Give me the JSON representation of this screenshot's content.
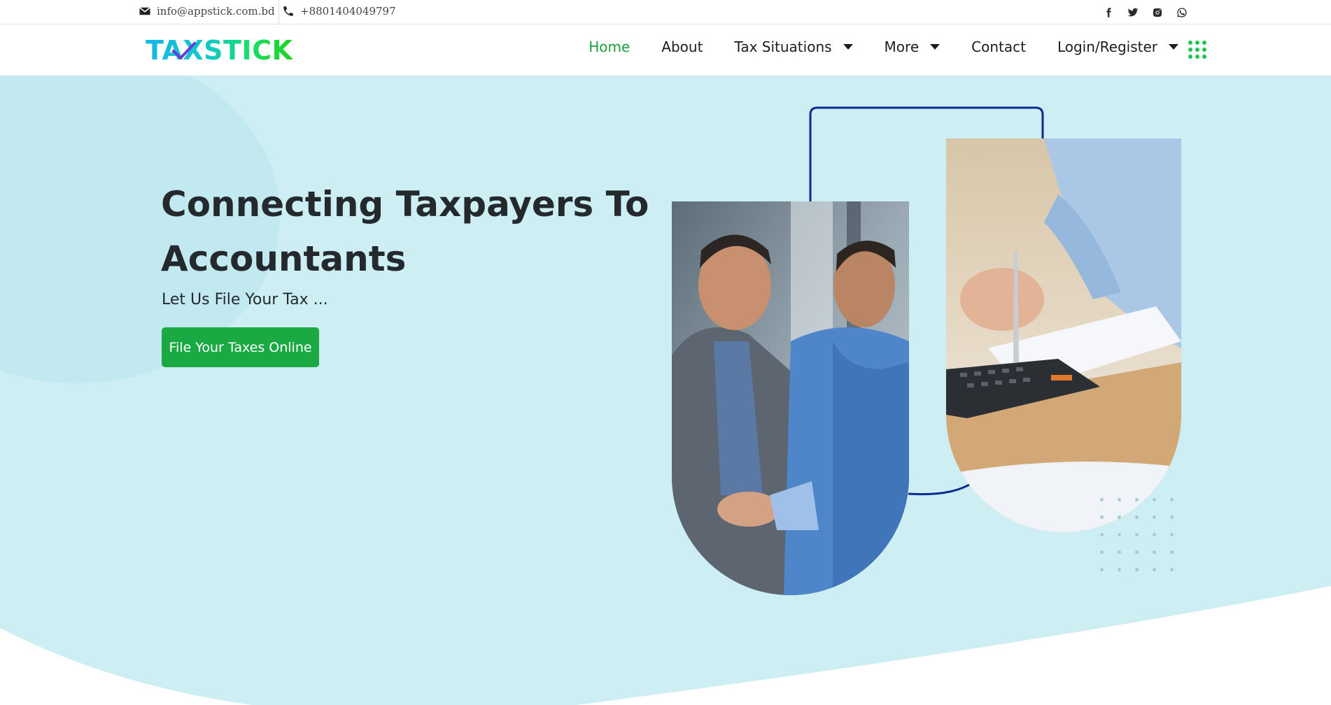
{
  "topbar": {
    "email": "info@appstick.com.bd",
    "phone": "+8801404049797",
    "social": [
      "facebook-icon",
      "twitter-icon",
      "instagram-icon",
      "whatsapp-icon"
    ]
  },
  "header": {
    "logo_text": "TAXSTICK",
    "nav": [
      {
        "label": "Home",
        "active": true,
        "dropdown": false
      },
      {
        "label": "About",
        "active": false,
        "dropdown": false
      },
      {
        "label": "Tax Situations",
        "active": false,
        "dropdown": true
      },
      {
        "label": "More",
        "active": false,
        "dropdown": true
      },
      {
        "label": "Contact",
        "active": false,
        "dropdown": false
      },
      {
        "label": "Login/Register",
        "active": false,
        "dropdown": true
      }
    ]
  },
  "hero": {
    "headline": "Connecting Taxpayers To Accountants",
    "subline": "Let Us File Your Tax ...",
    "cta_label": "File Your Taxes Online"
  },
  "colors": {
    "accent_green": "#1aa943",
    "nav_active": "#1e9c3e",
    "hero_bg": "#cdeff3",
    "frame_line": "#0d2b8f",
    "text_dark": "#24292e"
  }
}
